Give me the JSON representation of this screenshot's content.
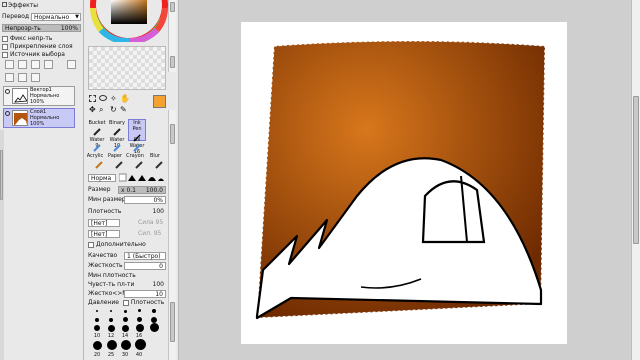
{
  "panel": {
    "title": "Эффекты",
    "blend_label": "Перевод",
    "blend_value": "Нормально",
    "opacity_label": "Непрозр-ть",
    "opacity_value": "100%",
    "opacity_fraction": 1.0,
    "checks": [
      "Фикс непр-ть",
      "Прикрепление слоя",
      "Источник выбора"
    ],
    "layers": [
      {
        "name": "Вектор1",
        "mode": "Нормально",
        "opacity": "100%",
        "selected": false
      },
      {
        "name": "Слой1",
        "mode": "Нормально",
        "opacity": "100%",
        "selected": true
      }
    ]
  },
  "tools": {
    "names": [
      "Bucket",
      "Binary",
      "Ink Pen",
      "Water",
      "Water",
      "Oil Water",
      "Acrylic",
      "Paper",
      "Crayon",
      "Blur"
    ],
    "numbers": [
      "9",
      "10",
      "16"
    ],
    "accent_color": "#f5a033",
    "mode_value": "Норма",
    "size_label": "Размер",
    "size_mult": "x 0.1",
    "size_value": "100.0",
    "min_size_label": "Мин размер",
    "min_size_value": "0%",
    "density_label": "Плотность",
    "density_value": "100",
    "none_1": "[Нет]",
    "strength_1": "Сила 95",
    "none_2": "[Нет]",
    "strength_2": "Сил. 95",
    "extra_label": "Дополнительно",
    "quality_label": "Качество",
    "quality_value": "1 (Быстро)",
    "hardness_label": "Жесткость",
    "hardness_value": "0",
    "min_density_label": "Мин плотность",
    "sensitivity_label": "Чувст-ть пл-ти",
    "sensitivity_value": "100",
    "hardsoft_label": "Жестко<>Мягко",
    "hardsoft_value": "10",
    "pressure_label": "Давление",
    "pressure_density": "Плотность",
    "dot_labels": [
      "10",
      "12",
      "14",
      "16",
      "20",
      "25",
      "30",
      "40"
    ]
  },
  "colors": {
    "canvas_bg": "#ffffff",
    "brown_light": "#d8771c",
    "brown_dark": "#6e2a00",
    "selection": "#c9c9f5"
  }
}
